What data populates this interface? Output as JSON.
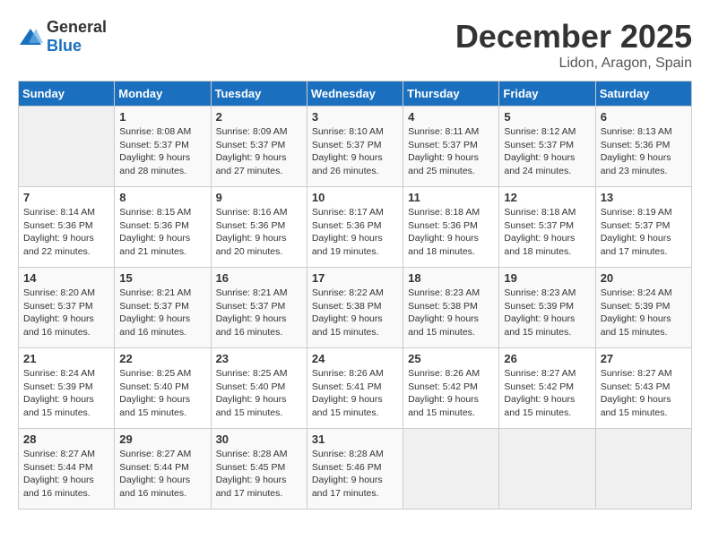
{
  "header": {
    "logo_general": "General",
    "logo_blue": "Blue",
    "month_title": "December 2025",
    "location": "Lidon, Aragon, Spain"
  },
  "days_of_week": [
    "Sunday",
    "Monday",
    "Tuesday",
    "Wednesday",
    "Thursday",
    "Friday",
    "Saturday"
  ],
  "weeks": [
    [
      {
        "day": "",
        "info": ""
      },
      {
        "day": "1",
        "info": "Sunrise: 8:08 AM\nSunset: 5:37 PM\nDaylight: 9 hours\nand 28 minutes."
      },
      {
        "day": "2",
        "info": "Sunrise: 8:09 AM\nSunset: 5:37 PM\nDaylight: 9 hours\nand 27 minutes."
      },
      {
        "day": "3",
        "info": "Sunrise: 8:10 AM\nSunset: 5:37 PM\nDaylight: 9 hours\nand 26 minutes."
      },
      {
        "day": "4",
        "info": "Sunrise: 8:11 AM\nSunset: 5:37 PM\nDaylight: 9 hours\nand 25 minutes."
      },
      {
        "day": "5",
        "info": "Sunrise: 8:12 AM\nSunset: 5:37 PM\nDaylight: 9 hours\nand 24 minutes."
      },
      {
        "day": "6",
        "info": "Sunrise: 8:13 AM\nSunset: 5:36 PM\nDaylight: 9 hours\nand 23 minutes."
      }
    ],
    [
      {
        "day": "7",
        "info": "Sunrise: 8:14 AM\nSunset: 5:36 PM\nDaylight: 9 hours\nand 22 minutes."
      },
      {
        "day": "8",
        "info": "Sunrise: 8:15 AM\nSunset: 5:36 PM\nDaylight: 9 hours\nand 21 minutes."
      },
      {
        "day": "9",
        "info": "Sunrise: 8:16 AM\nSunset: 5:36 PM\nDaylight: 9 hours\nand 20 minutes."
      },
      {
        "day": "10",
        "info": "Sunrise: 8:17 AM\nSunset: 5:36 PM\nDaylight: 9 hours\nand 19 minutes."
      },
      {
        "day": "11",
        "info": "Sunrise: 8:18 AM\nSunset: 5:36 PM\nDaylight: 9 hours\nand 18 minutes."
      },
      {
        "day": "12",
        "info": "Sunrise: 8:18 AM\nSunset: 5:37 PM\nDaylight: 9 hours\nand 18 minutes."
      },
      {
        "day": "13",
        "info": "Sunrise: 8:19 AM\nSunset: 5:37 PM\nDaylight: 9 hours\nand 17 minutes."
      }
    ],
    [
      {
        "day": "14",
        "info": "Sunrise: 8:20 AM\nSunset: 5:37 PM\nDaylight: 9 hours\nand 16 minutes."
      },
      {
        "day": "15",
        "info": "Sunrise: 8:21 AM\nSunset: 5:37 PM\nDaylight: 9 hours\nand 16 minutes."
      },
      {
        "day": "16",
        "info": "Sunrise: 8:21 AM\nSunset: 5:37 PM\nDaylight: 9 hours\nand 16 minutes."
      },
      {
        "day": "17",
        "info": "Sunrise: 8:22 AM\nSunset: 5:38 PM\nDaylight: 9 hours\nand 15 minutes."
      },
      {
        "day": "18",
        "info": "Sunrise: 8:23 AM\nSunset: 5:38 PM\nDaylight: 9 hours\nand 15 minutes."
      },
      {
        "day": "19",
        "info": "Sunrise: 8:23 AM\nSunset: 5:39 PM\nDaylight: 9 hours\nand 15 minutes."
      },
      {
        "day": "20",
        "info": "Sunrise: 8:24 AM\nSunset: 5:39 PM\nDaylight: 9 hours\nand 15 minutes."
      }
    ],
    [
      {
        "day": "21",
        "info": "Sunrise: 8:24 AM\nSunset: 5:39 PM\nDaylight: 9 hours\nand 15 minutes."
      },
      {
        "day": "22",
        "info": "Sunrise: 8:25 AM\nSunset: 5:40 PM\nDaylight: 9 hours\nand 15 minutes."
      },
      {
        "day": "23",
        "info": "Sunrise: 8:25 AM\nSunset: 5:40 PM\nDaylight: 9 hours\nand 15 minutes."
      },
      {
        "day": "24",
        "info": "Sunrise: 8:26 AM\nSunset: 5:41 PM\nDaylight: 9 hours\nand 15 minutes."
      },
      {
        "day": "25",
        "info": "Sunrise: 8:26 AM\nSunset: 5:42 PM\nDaylight: 9 hours\nand 15 minutes."
      },
      {
        "day": "26",
        "info": "Sunrise: 8:27 AM\nSunset: 5:42 PM\nDaylight: 9 hours\nand 15 minutes."
      },
      {
        "day": "27",
        "info": "Sunrise: 8:27 AM\nSunset: 5:43 PM\nDaylight: 9 hours\nand 15 minutes."
      }
    ],
    [
      {
        "day": "28",
        "info": "Sunrise: 8:27 AM\nSunset: 5:44 PM\nDaylight: 9 hours\nand 16 minutes."
      },
      {
        "day": "29",
        "info": "Sunrise: 8:27 AM\nSunset: 5:44 PM\nDaylight: 9 hours\nand 16 minutes."
      },
      {
        "day": "30",
        "info": "Sunrise: 8:28 AM\nSunset: 5:45 PM\nDaylight: 9 hours\nand 17 minutes."
      },
      {
        "day": "31",
        "info": "Sunrise: 8:28 AM\nSunset: 5:46 PM\nDaylight: 9 hours\nand 17 minutes."
      },
      {
        "day": "",
        "info": ""
      },
      {
        "day": "",
        "info": ""
      },
      {
        "day": "",
        "info": ""
      }
    ]
  ]
}
